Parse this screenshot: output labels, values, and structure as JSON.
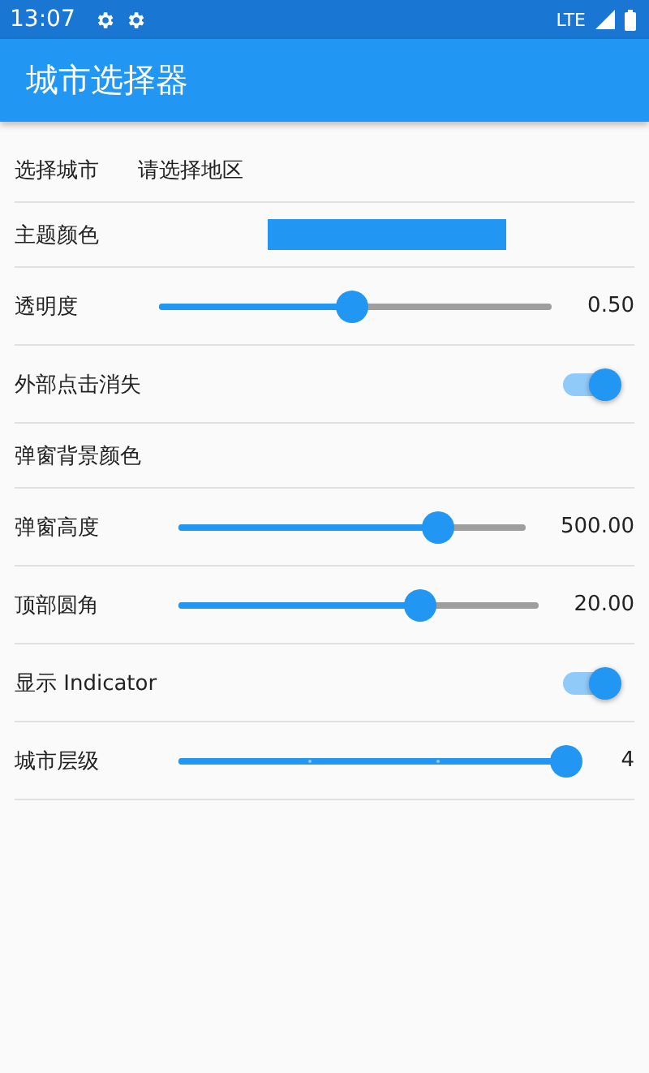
{
  "status_bar": {
    "time": "13:07",
    "network": "LTE"
  },
  "app_bar": {
    "title": "城市选择器"
  },
  "rows": [
    {
      "kind": "picker",
      "label": "选择城市",
      "placeholder": "请选择地区"
    },
    {
      "kind": "color",
      "label": "主题颜色",
      "color": "#2196f3"
    },
    {
      "kind": "slider",
      "label": "透明度",
      "level": 0.49,
      "reading": "0.50"
    },
    {
      "kind": "switch",
      "label": "外部点击消失",
      "on": true
    },
    {
      "kind": "label",
      "label": "弹窗背景颜色"
    },
    {
      "kind": "slider",
      "label": "弹窗高度",
      "level": 0.75,
      "reading": "500.00"
    },
    {
      "kind": "slider",
      "label": "顶部圆角",
      "level": 0.67,
      "reading": "20.00"
    },
    {
      "kind": "switch",
      "label": "显示 Indicator",
      "on": true
    },
    {
      "kind": "stepped-slider",
      "label": "城市层级",
      "level": 1,
      "reading": "4"
    }
  ]
}
